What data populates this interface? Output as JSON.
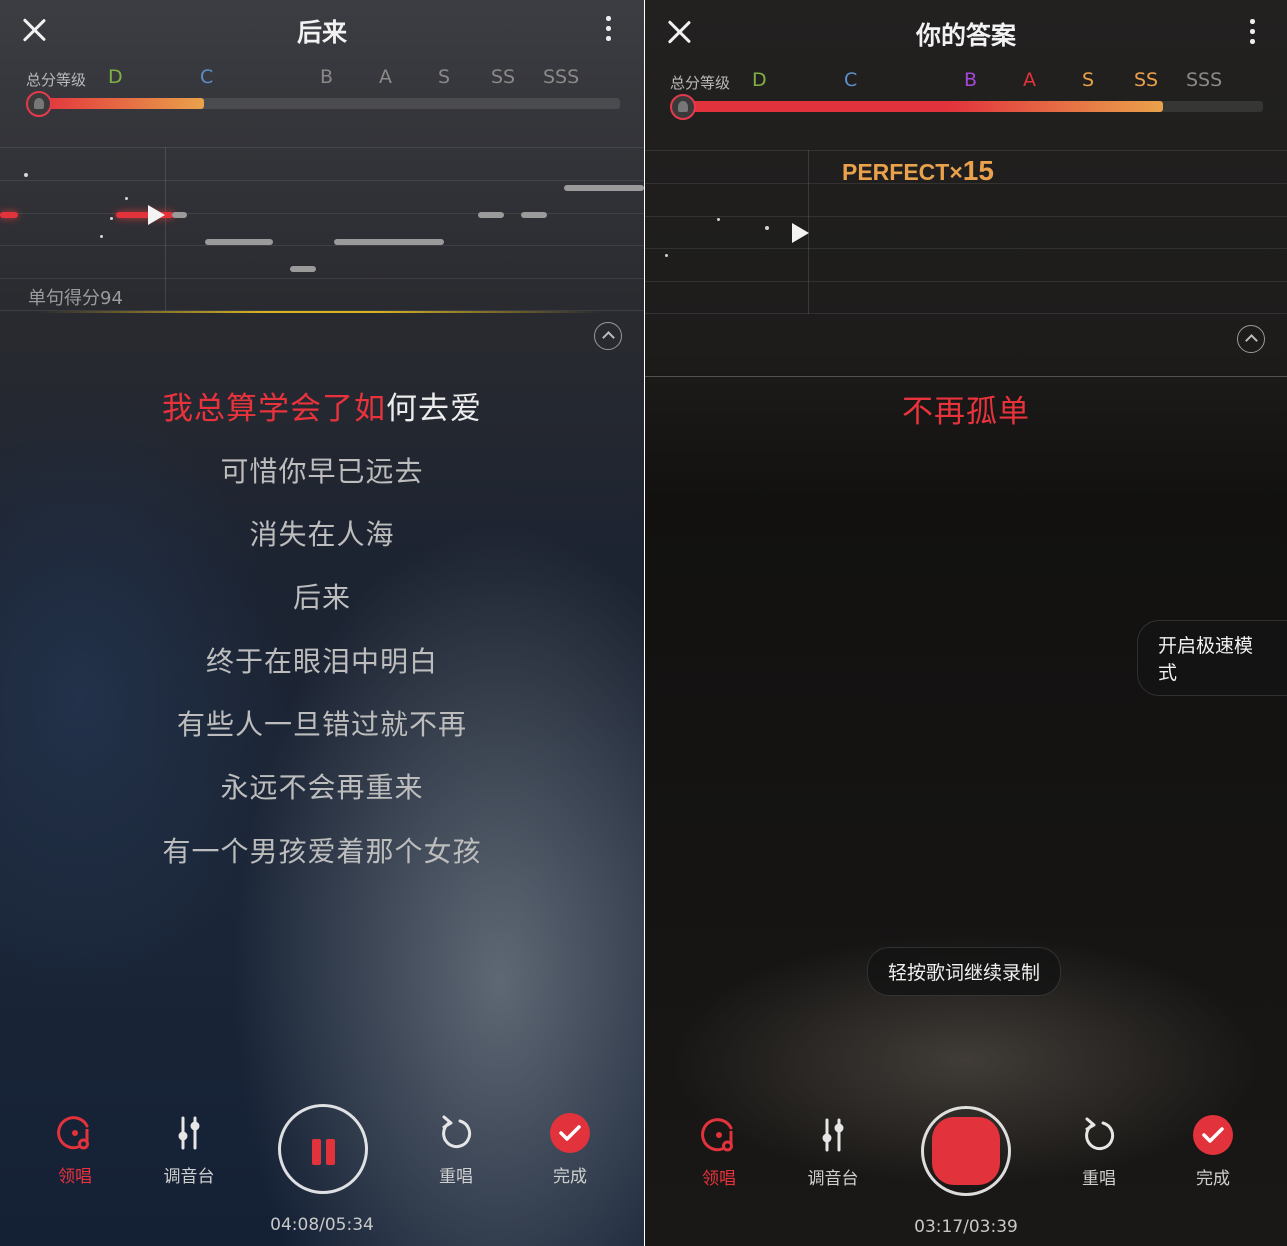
{
  "colors": {
    "accent": "#e2323c",
    "gold": "#d8b320",
    "perfect": "#e9a24b"
  },
  "left": {
    "title": "后来",
    "grade_label": "总分等级",
    "grades": [
      {
        "label": "D",
        "color": "#7fb243"
      },
      {
        "label": "C",
        "color": "#5d8ec9"
      },
      {
        "label": "B",
        "color": "#8a8a8a"
      },
      {
        "label": "A",
        "color": "#8a8a8a"
      },
      {
        "label": "S",
        "color": "#8a8a8a"
      },
      {
        "label": "SS",
        "color": "#8a8a8a"
      },
      {
        "label": "SSS",
        "color": "#8a8a8a"
      }
    ],
    "sentence_score": "单句得分94",
    "current_lyric_sung": "我总算学会了如",
    "current_lyric_rest": "何去爱",
    "lyrics": [
      "可惜你早已远去",
      "消失在人海",
      "后来",
      "终于在眼泪中明白",
      "有些人一旦错过就不再",
      "永远不会再重来",
      "有一个男孩爱着那个女孩"
    ],
    "toolbar": {
      "guide": "领唱",
      "mixer": "调音台",
      "retry": "重唱",
      "done": "完成"
    },
    "time": "04:08/05:34",
    "play_state": "paused-icon"
  },
  "right": {
    "title": "你的答案",
    "grade_label": "总分等级",
    "grades": [
      {
        "label": "D",
        "color": "#7fb243"
      },
      {
        "label": "C",
        "color": "#5d8ec9"
      },
      {
        "label": "B",
        "color": "#a548d8"
      },
      {
        "label": "A",
        "color": "#e2323c"
      },
      {
        "label": "S",
        "color": "#e9a24b"
      },
      {
        "label": "SS",
        "color": "#e9a24b"
      },
      {
        "label": "SSS",
        "color": "#8a8a8a"
      }
    ],
    "perfect_text": "PERFECT×",
    "perfect_count": "15",
    "current_lyric": "不再孤单",
    "fast_mode": "开启极速模式",
    "hint": "轻按歌词继续录制",
    "toolbar": {
      "guide": "领唱",
      "mixer": "调音台",
      "retry": "重唱",
      "done": "完成"
    },
    "time": "03:17/03:39"
  }
}
